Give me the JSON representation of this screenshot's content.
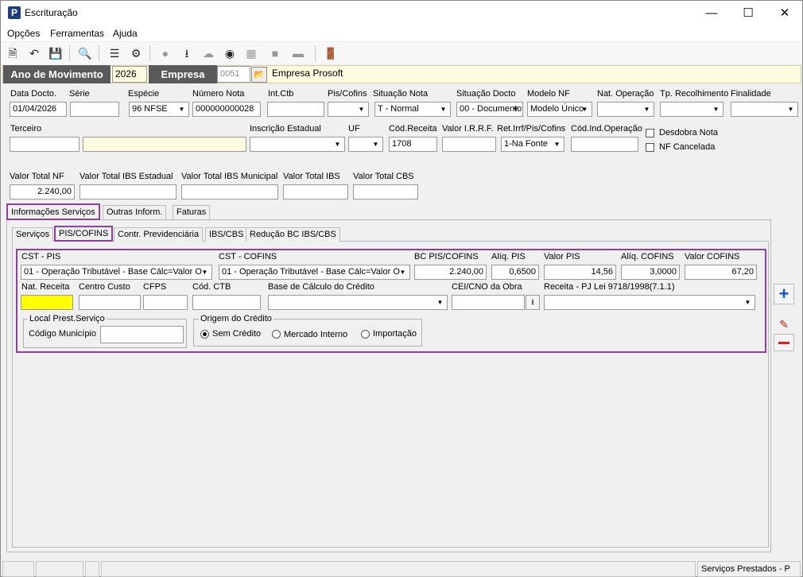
{
  "window": {
    "title": "Escrituração",
    "app_icon": "P"
  },
  "menu": [
    "Opções",
    "Ferramentas",
    "Ajuda"
  ],
  "toolbar_icons": [
    "new-icon",
    "undo-icon",
    "save-icon",
    "preview-icon",
    "tree-icon",
    "gear-icon",
    "apple-icon",
    "download-icon",
    "cloud-icon",
    "cib-icon",
    "grid-icon",
    "square-icon",
    "minus-icon",
    "exit-icon"
  ],
  "header": {
    "ano_label": "Ano de Movimento",
    "ano_value": "2026",
    "empresa_label": "Empresa",
    "empresa_code": "0051",
    "empresa_name": "Empresa Prosoft"
  },
  "row1": {
    "labels": [
      "Data Docto.",
      "Série",
      "Espécie",
      "Número Nota",
      "Int.Ctb",
      "Pis/Cofins",
      "Situação Nota",
      "Situação Docto",
      "Modelo NF",
      "Nat. Operação",
      "Tp. Recolhimento",
      "Finalidade"
    ],
    "data_docto": "01/04/2026",
    "serie": "",
    "especie": "96 NFSE",
    "numero_nota": "000000000028",
    "int_ctb": "",
    "pis_cofins": "",
    "situacao_nota": "T - Normal",
    "situacao_docto": "00 - Documento",
    "modelo_nf": "Modelo Único",
    "nat_operacao": "",
    "tp_recolhimento": "",
    "finalidade": ""
  },
  "row2": {
    "terceiro_label": "Terceiro",
    "terceiro_code": "",
    "terceiro_name": "",
    "insc_label": "Inscrição Estadual",
    "insc_value": "",
    "uf_label": "UF",
    "uf_value": "",
    "cod_receita_label": "Cód.Receita",
    "cod_receita_value": "1708",
    "irrf_label": "Valor I.R.R.F.",
    "irrf_value": "",
    "ret_label": "Ret.Irrf/Pis/Cofins",
    "ret_value": "1-Na Fonte",
    "codind_label": "Cód.Ind.Operação",
    "codind_value": "",
    "desdobra": "Desdobra Nota",
    "cancelada": "NF Cancelada"
  },
  "totals": {
    "labels": [
      "Valor Total NF",
      "Valor Total IBS Estadual",
      "Valor Total IBS Municipal",
      "Valor Total IBS",
      "Valor Total CBS"
    ],
    "valor_total_nf": "2.240,00",
    "ibs_estadual": "",
    "ibs_municipal": "",
    "ibs": "",
    "cbs": ""
  },
  "tabs_main": [
    "Informações Serviços",
    "Outras Inform.",
    "Faturas"
  ],
  "tabs_sub": [
    "Serviços",
    "PIS/COFINS",
    "Contr. Previdenciária",
    "IBS/CBS",
    "Redução BC IBS/CBS"
  ],
  "pis": {
    "cst_pis_label": "CST - PIS",
    "cst_pis": "01 - Operação Tributável - Base Cálc=Valor O",
    "cst_cofins_label": "CST - COFINS",
    "cst_cofins": "01 - Operação Tributável - Base Cálc=Valor O",
    "bc_label": "BC PIS/COFINS",
    "bc": "2.240,00",
    "aliq_pis_label": "Alíq. PIS",
    "aliq_pis": "0,6500",
    "valor_pis_label": "Valor PIS",
    "valor_pis": "14,56",
    "aliq_cofins_label": "Alíq. COFINS",
    "aliq_cofins": "3,0000",
    "valor_cofins_label": "Valor COFINS",
    "valor_cofins": "67,20",
    "nat_receita_label": "Nat. Receita",
    "nat_receita": "",
    "centro_custo_label": "Centro Custo",
    "centro_custo": "",
    "cfps_label": "CFPS",
    "cfps": "",
    "cod_ctb_label": "Cód. CTB",
    "cod_ctb": "",
    "base_credito_label": "Base de Cálculo do Crédito",
    "base_credito": "",
    "cei_label": "CEI/CNO da Obra",
    "cei": "",
    "receita_label": "Receita - PJ Lei 9718/1998(7.1.1)",
    "receita": "",
    "local_label": "Local Prest.Serviço",
    "codigo_municipio_label": "Código Município",
    "codigo_municipio": "",
    "origem_label": "Origem do Crédito",
    "origem_options": [
      "Sem Crédito",
      "Mercado Interno",
      "Importação"
    ],
    "origem_selected": 0
  },
  "side_buttons": [
    "plus-icon",
    "edit-icon",
    "remove-icon"
  ],
  "statusbar": {
    "right": "Serviços Prestados - P"
  },
  "colors": {
    "accent": "#8e3e9e",
    "dark": "#5a5a5a",
    "yellow": "#ffff00",
    "pale": "#fffbe0"
  }
}
